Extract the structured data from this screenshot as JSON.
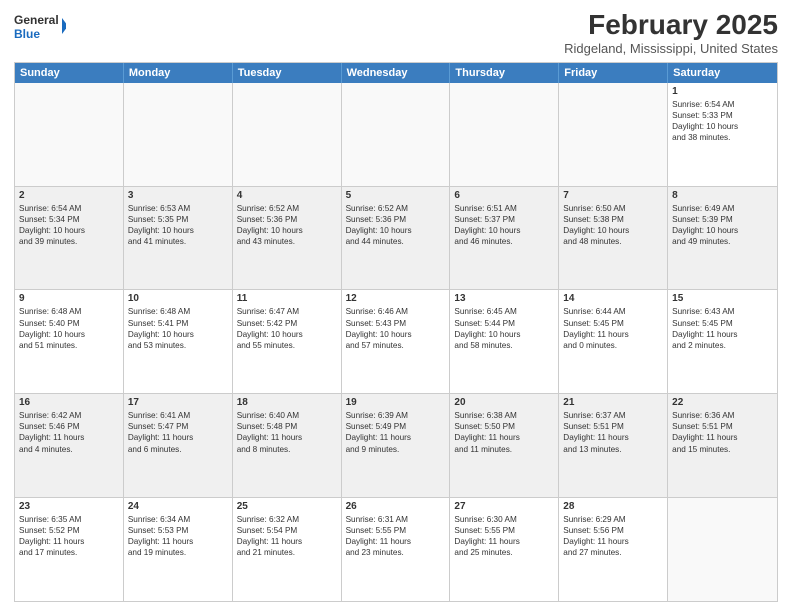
{
  "header": {
    "logo": {
      "general": "General",
      "blue": "Blue"
    },
    "title": "February 2025",
    "location": "Ridgeland, Mississippi, United States"
  },
  "calendar": {
    "days": [
      "Sunday",
      "Monday",
      "Tuesday",
      "Wednesday",
      "Thursday",
      "Friday",
      "Saturday"
    ],
    "rows": [
      [
        {
          "day": "",
          "text": ""
        },
        {
          "day": "",
          "text": ""
        },
        {
          "day": "",
          "text": ""
        },
        {
          "day": "",
          "text": ""
        },
        {
          "day": "",
          "text": ""
        },
        {
          "day": "",
          "text": ""
        },
        {
          "day": "1",
          "text": "Sunrise: 6:54 AM\nSunset: 5:33 PM\nDaylight: 10 hours\nand 38 minutes."
        }
      ],
      [
        {
          "day": "2",
          "text": "Sunrise: 6:54 AM\nSunset: 5:34 PM\nDaylight: 10 hours\nand 39 minutes."
        },
        {
          "day": "3",
          "text": "Sunrise: 6:53 AM\nSunset: 5:35 PM\nDaylight: 10 hours\nand 41 minutes."
        },
        {
          "day": "4",
          "text": "Sunrise: 6:52 AM\nSunset: 5:36 PM\nDaylight: 10 hours\nand 43 minutes."
        },
        {
          "day": "5",
          "text": "Sunrise: 6:52 AM\nSunset: 5:36 PM\nDaylight: 10 hours\nand 44 minutes."
        },
        {
          "day": "6",
          "text": "Sunrise: 6:51 AM\nSunset: 5:37 PM\nDaylight: 10 hours\nand 46 minutes."
        },
        {
          "day": "7",
          "text": "Sunrise: 6:50 AM\nSunset: 5:38 PM\nDaylight: 10 hours\nand 48 minutes."
        },
        {
          "day": "8",
          "text": "Sunrise: 6:49 AM\nSunset: 5:39 PM\nDaylight: 10 hours\nand 49 minutes."
        }
      ],
      [
        {
          "day": "9",
          "text": "Sunrise: 6:48 AM\nSunset: 5:40 PM\nDaylight: 10 hours\nand 51 minutes."
        },
        {
          "day": "10",
          "text": "Sunrise: 6:48 AM\nSunset: 5:41 PM\nDaylight: 10 hours\nand 53 minutes."
        },
        {
          "day": "11",
          "text": "Sunrise: 6:47 AM\nSunset: 5:42 PM\nDaylight: 10 hours\nand 55 minutes."
        },
        {
          "day": "12",
          "text": "Sunrise: 6:46 AM\nSunset: 5:43 PM\nDaylight: 10 hours\nand 57 minutes."
        },
        {
          "day": "13",
          "text": "Sunrise: 6:45 AM\nSunset: 5:44 PM\nDaylight: 10 hours\nand 58 minutes."
        },
        {
          "day": "14",
          "text": "Sunrise: 6:44 AM\nSunset: 5:45 PM\nDaylight: 11 hours\nand 0 minutes."
        },
        {
          "day": "15",
          "text": "Sunrise: 6:43 AM\nSunset: 5:45 PM\nDaylight: 11 hours\nand 2 minutes."
        }
      ],
      [
        {
          "day": "16",
          "text": "Sunrise: 6:42 AM\nSunset: 5:46 PM\nDaylight: 11 hours\nand 4 minutes."
        },
        {
          "day": "17",
          "text": "Sunrise: 6:41 AM\nSunset: 5:47 PM\nDaylight: 11 hours\nand 6 minutes."
        },
        {
          "day": "18",
          "text": "Sunrise: 6:40 AM\nSunset: 5:48 PM\nDaylight: 11 hours\nand 8 minutes."
        },
        {
          "day": "19",
          "text": "Sunrise: 6:39 AM\nSunset: 5:49 PM\nDaylight: 11 hours\nand 9 minutes."
        },
        {
          "day": "20",
          "text": "Sunrise: 6:38 AM\nSunset: 5:50 PM\nDaylight: 11 hours\nand 11 minutes."
        },
        {
          "day": "21",
          "text": "Sunrise: 6:37 AM\nSunset: 5:51 PM\nDaylight: 11 hours\nand 13 minutes."
        },
        {
          "day": "22",
          "text": "Sunrise: 6:36 AM\nSunset: 5:51 PM\nDaylight: 11 hours\nand 15 minutes."
        }
      ],
      [
        {
          "day": "23",
          "text": "Sunrise: 6:35 AM\nSunset: 5:52 PM\nDaylight: 11 hours\nand 17 minutes."
        },
        {
          "day": "24",
          "text": "Sunrise: 6:34 AM\nSunset: 5:53 PM\nDaylight: 11 hours\nand 19 minutes."
        },
        {
          "day": "25",
          "text": "Sunrise: 6:32 AM\nSunset: 5:54 PM\nDaylight: 11 hours\nand 21 minutes."
        },
        {
          "day": "26",
          "text": "Sunrise: 6:31 AM\nSunset: 5:55 PM\nDaylight: 11 hours\nand 23 minutes."
        },
        {
          "day": "27",
          "text": "Sunrise: 6:30 AM\nSunset: 5:55 PM\nDaylight: 11 hours\nand 25 minutes."
        },
        {
          "day": "28",
          "text": "Sunrise: 6:29 AM\nSunset: 5:56 PM\nDaylight: 11 hours\nand 27 minutes."
        },
        {
          "day": "",
          "text": ""
        }
      ]
    ]
  }
}
